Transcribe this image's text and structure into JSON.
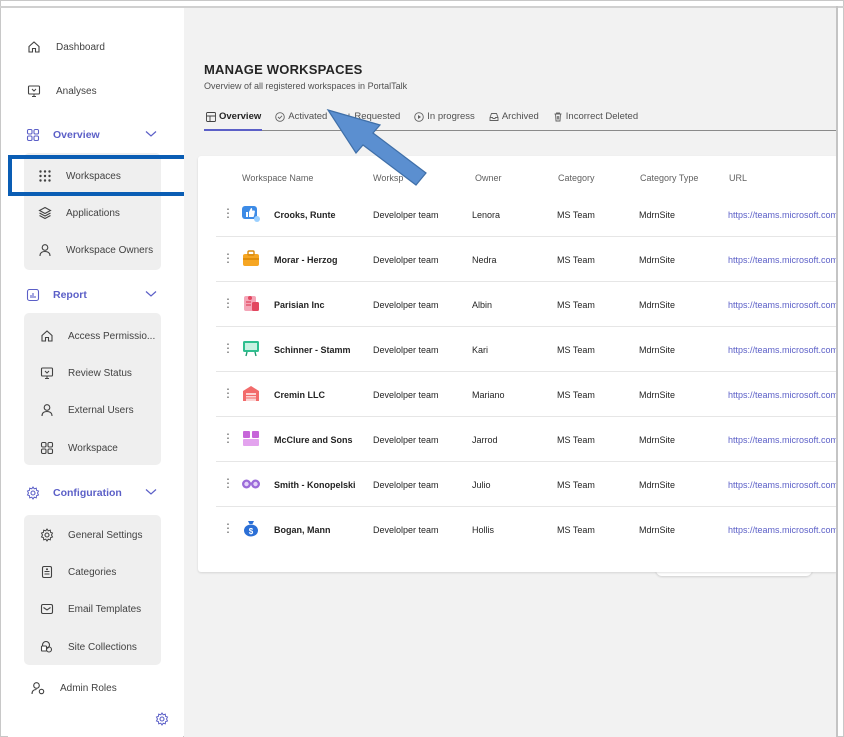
{
  "sidebar": {
    "dashboard": "Dashboard",
    "analyses": "Analyses",
    "overview": {
      "label": "Overview",
      "items": [
        "Workspaces",
        "Applications",
        "Workspace Owners"
      ]
    },
    "report": {
      "label": "Report",
      "items": [
        "Access Permissio...",
        "Review Status",
        "External Users",
        "Workspace"
      ]
    },
    "configuration": {
      "label": "Configuration",
      "items": [
        "General Settings",
        "Categories",
        "Email Templates",
        "Site Collections"
      ]
    },
    "admin_roles": "Admin Roles"
  },
  "main": {
    "title": "MANAGE WORKSPACES",
    "subtitle": "Overview of all registered workspaces in PortalTalk",
    "tabs": [
      "Overview",
      "Activated",
      "Requested",
      "In progress",
      "Archived",
      "Incorrect Deleted"
    ],
    "columns": [
      "Workspace Name",
      "Worksp",
      "Owner",
      "Category",
      "Category Type",
      "URL"
    ],
    "rows": [
      {
        "name": "Crooks, Runte",
        "workspace": "Develolper team",
        "owner": "Lenora",
        "category": "MS Team",
        "type": "MdrnSite",
        "url": "https://teams.microsoft.com..."
      },
      {
        "name": "Morar - Herzog",
        "workspace": "Develolper team",
        "owner": "Nedra",
        "category": "MS Team",
        "type": "MdrnSite",
        "url": "https://teams.microsoft.com..."
      },
      {
        "name": "Parisian Inc",
        "workspace": "Develolper team",
        "owner": "Albin",
        "category": "MS Team",
        "type": "MdrnSite",
        "url": "https://teams.microsoft.com..."
      },
      {
        "name": "Schinner - Stamm",
        "workspace": "Develolper team",
        "owner": "Kari",
        "category": "MS Team",
        "type": "MdrnSite",
        "url": "https://teams.microsoft.com..."
      },
      {
        "name": "Cremin LLC",
        "workspace": "Develolper team",
        "owner": "Mariano",
        "category": "MS Team",
        "type": "MdrnSite",
        "url": "https://teams.microsoft.com..."
      },
      {
        "name": "McClure and Sons",
        "workspace": "Develolper team",
        "owner": "Jarrod",
        "category": "MS Team",
        "type": "MdrnSite",
        "url": "https://teams.microsoft.com..."
      },
      {
        "name": "Smith - Konopelski",
        "workspace": "Develolper team",
        "owner": "Julio",
        "category": "MS Team",
        "type": "MdrnSite",
        "url": "https://teams.microsoft.com..."
      },
      {
        "name": "Bogan, Mann",
        "workspace": "Develolper team",
        "owner": "Hollis",
        "category": "MS Team",
        "type": "MdrnSite",
        "url": "https://teams.microsoft.com..."
      }
    ]
  },
  "colors": {
    "accent": "#5b5fc7",
    "highlight_box": "#0a5db4",
    "arrow": "#5b8fd0"
  }
}
